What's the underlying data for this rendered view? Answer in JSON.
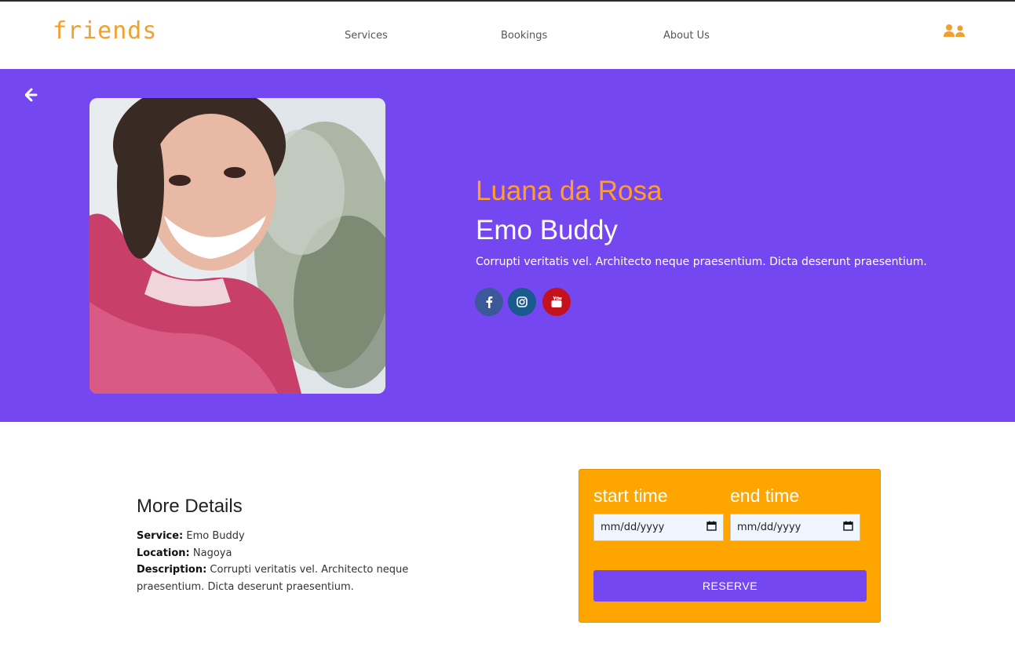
{
  "brand": {
    "logo": "friends",
    "accent": "#ff9f2a",
    "hero_bg": "#7547f0"
  },
  "nav": {
    "services": "Services",
    "bookings": "Bookings",
    "about": "About Us",
    "user_icon": "users-icon"
  },
  "profile": {
    "name": "Luana da Rosa",
    "service": "Emo Buddy",
    "description": "Corrupti veritatis vel. Architecto neque praesentium. Dicta deserunt praesentium.",
    "social": [
      "facebook-icon",
      "instagram-icon",
      "youtube-icon"
    ]
  },
  "details": {
    "title": "More Details",
    "service_label": "Service:",
    "service_value": "Emo Buddy",
    "location_label": "Location:",
    "location_value": "Nagoya",
    "description_label": "Description:",
    "description_value": "Corrupti veritatis vel. Architecto neque praesentium. Dicta deserunt praesentium."
  },
  "booking": {
    "start_label": "start time",
    "end_label": "end time",
    "start_placeholder": "mm/dd/yyyy",
    "end_placeholder": "mm/dd/yyyy",
    "reserve": "RESERVE",
    "bg": "#ffa500"
  }
}
